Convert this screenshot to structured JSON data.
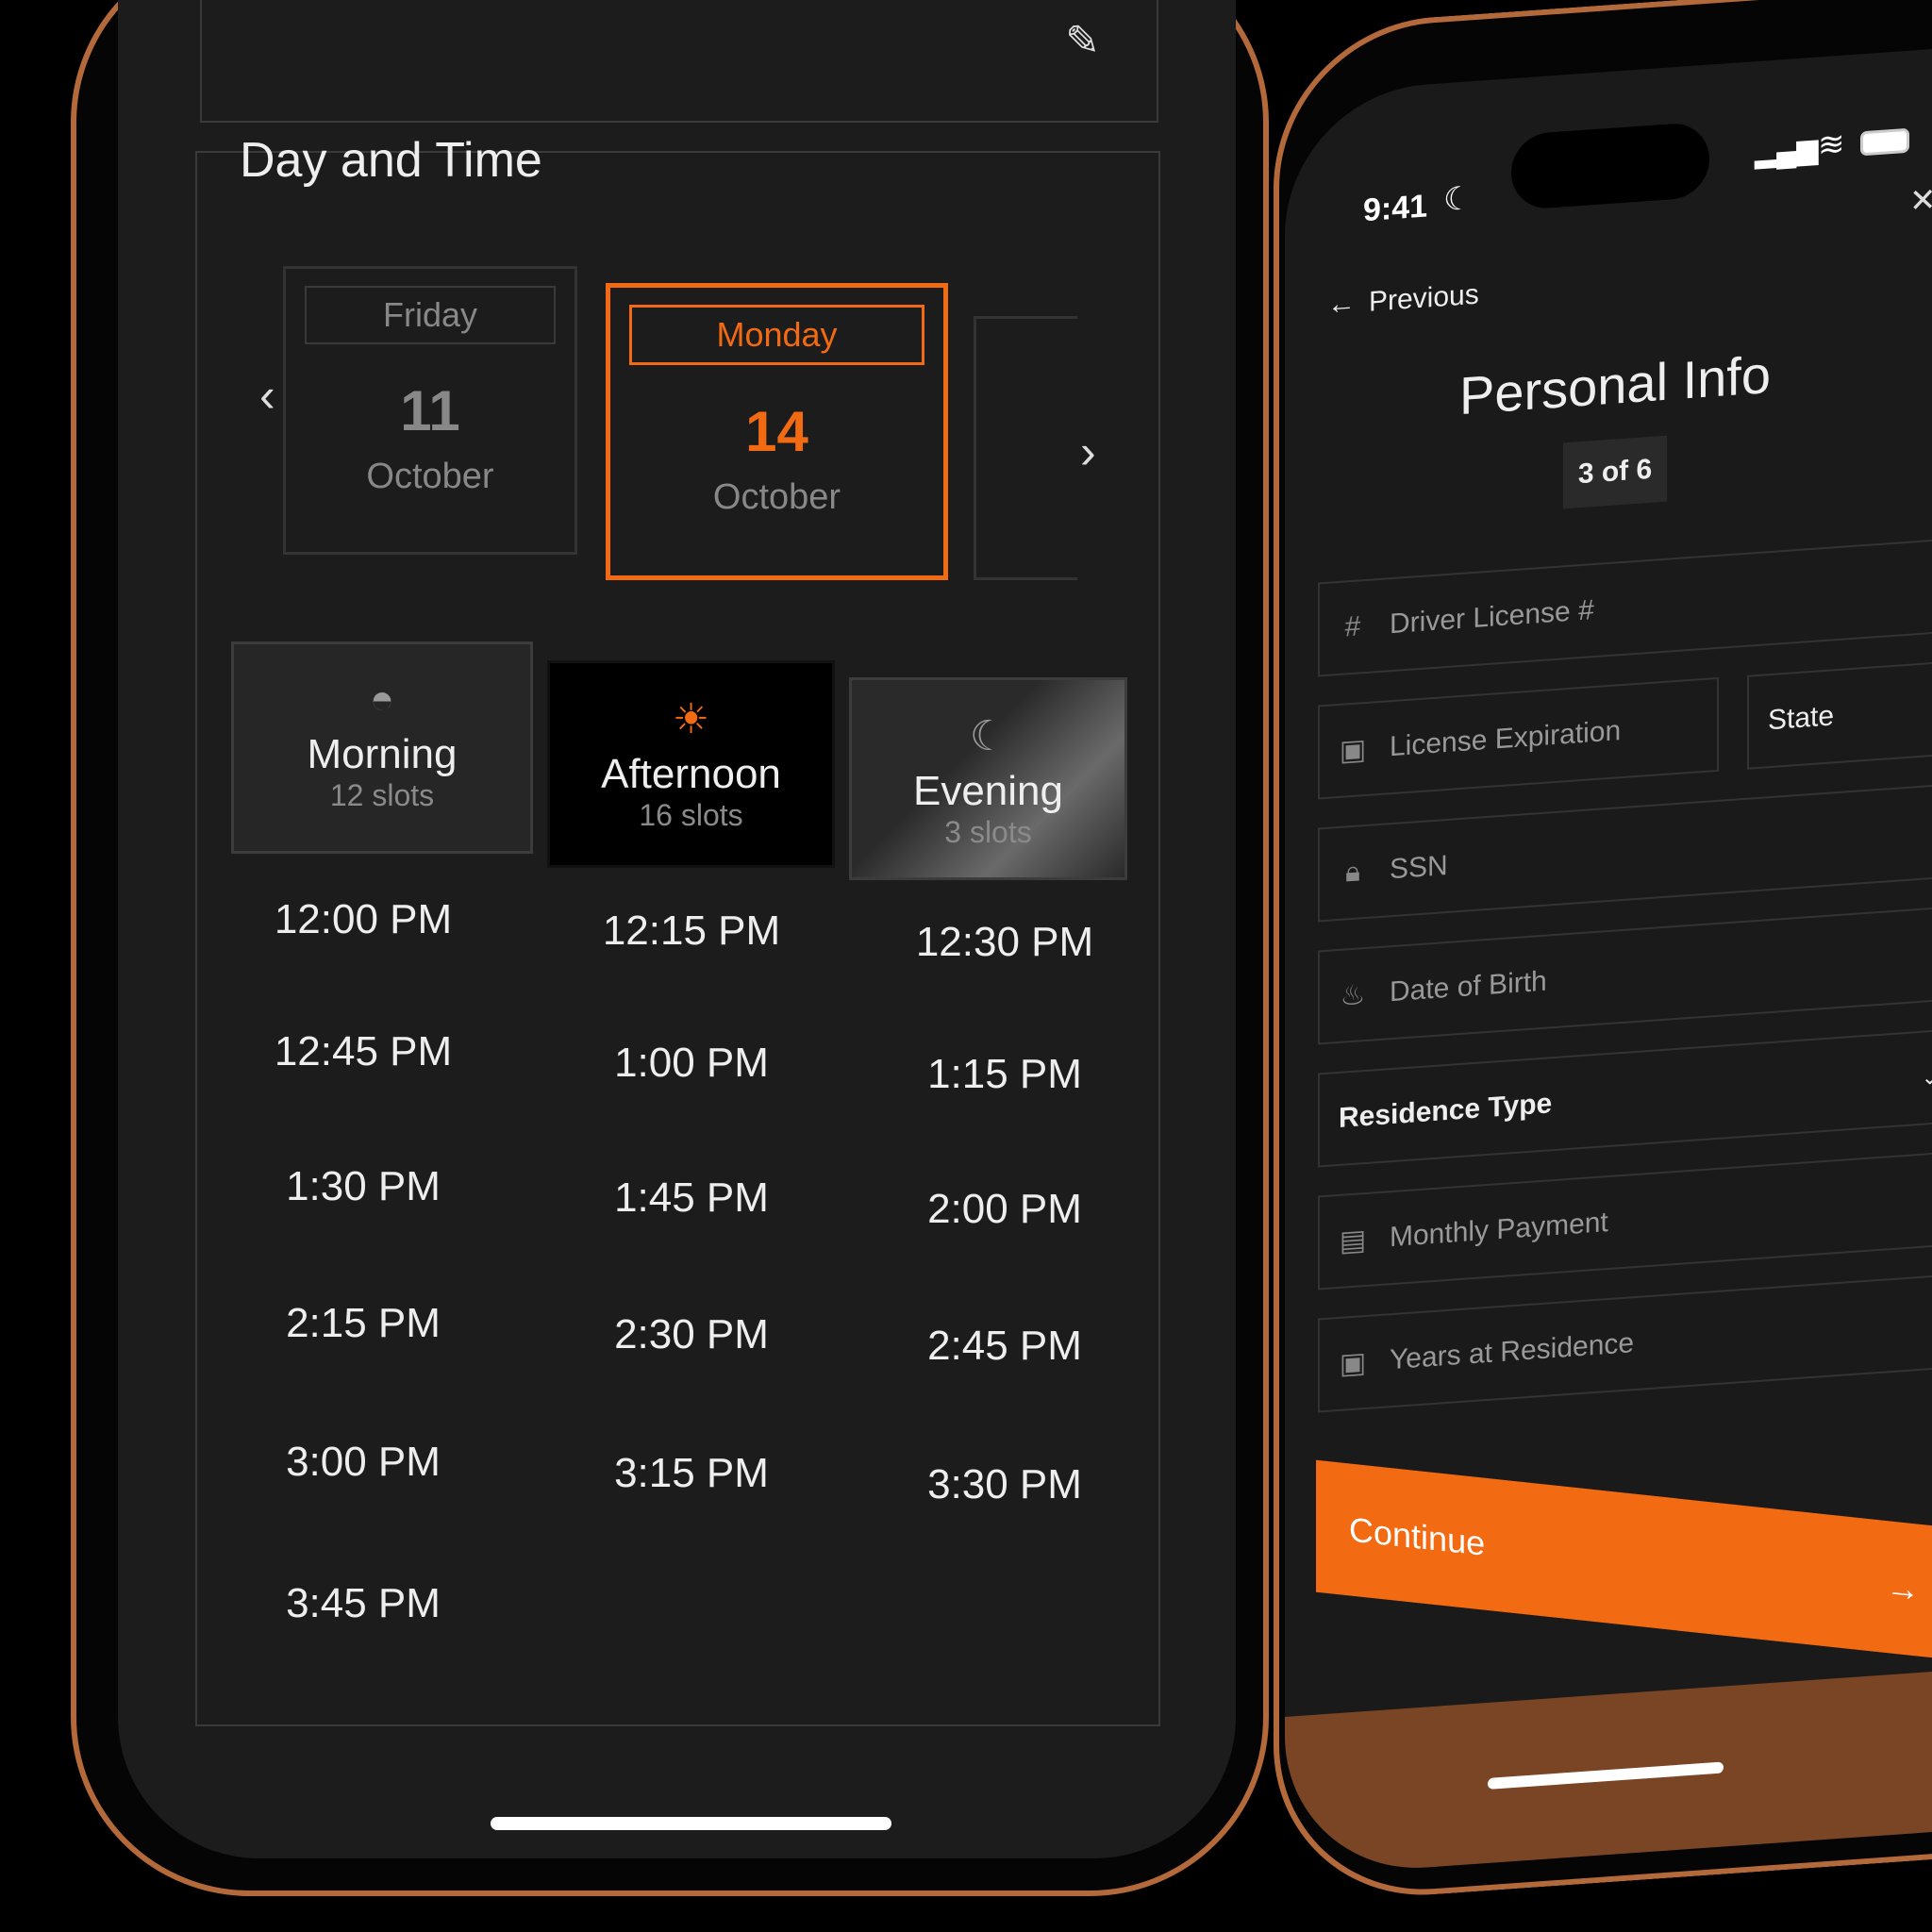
{
  "booking": {
    "title": "Day and Time",
    "days": [
      {
        "weekday": "Friday",
        "day": "11",
        "month": "October",
        "selected": false
      },
      {
        "weekday": "Monday",
        "day": "14",
        "month": "October",
        "selected": true
      }
    ],
    "periods": [
      {
        "label": "Morning",
        "slots": "12 slots",
        "icon": "sunrise-icon",
        "selected": false
      },
      {
        "label": "Afternoon",
        "slots": "16 slots",
        "icon": "sun-icon",
        "selected": true
      },
      {
        "label": "Evening",
        "slots": "3 slots",
        "icon": "moon-icon",
        "selected": false
      }
    ],
    "times": [
      "12:00 PM",
      "12:15 PM",
      "12:30 PM",
      "12:45 PM",
      "1:00 PM",
      "1:15 PM",
      "1:30 PM",
      "1:45 PM",
      "2:00 PM",
      "2:15 PM",
      "2:30 PM",
      "2:45 PM",
      "3:00 PM",
      "3:15 PM",
      "3:30 PM",
      "3:45 PM"
    ]
  },
  "status": {
    "time": "9:41"
  },
  "form": {
    "back_label": "Previous",
    "title": "Personal Info",
    "step": "3 of 6",
    "fields": {
      "driver_license": "Driver License #",
      "license_expiration": "License Expiration",
      "state": "State",
      "ssn": "SSN",
      "dob": "Date of Birth",
      "residence_type": "Residence Type",
      "monthly_payment": "Monthly Payment",
      "years_at_residence": "Years at Residence"
    },
    "continue_label": "Continue"
  },
  "colors": {
    "accent": "#f26a12",
    "background": "#1c1c1c",
    "frame": "#b4693a"
  }
}
